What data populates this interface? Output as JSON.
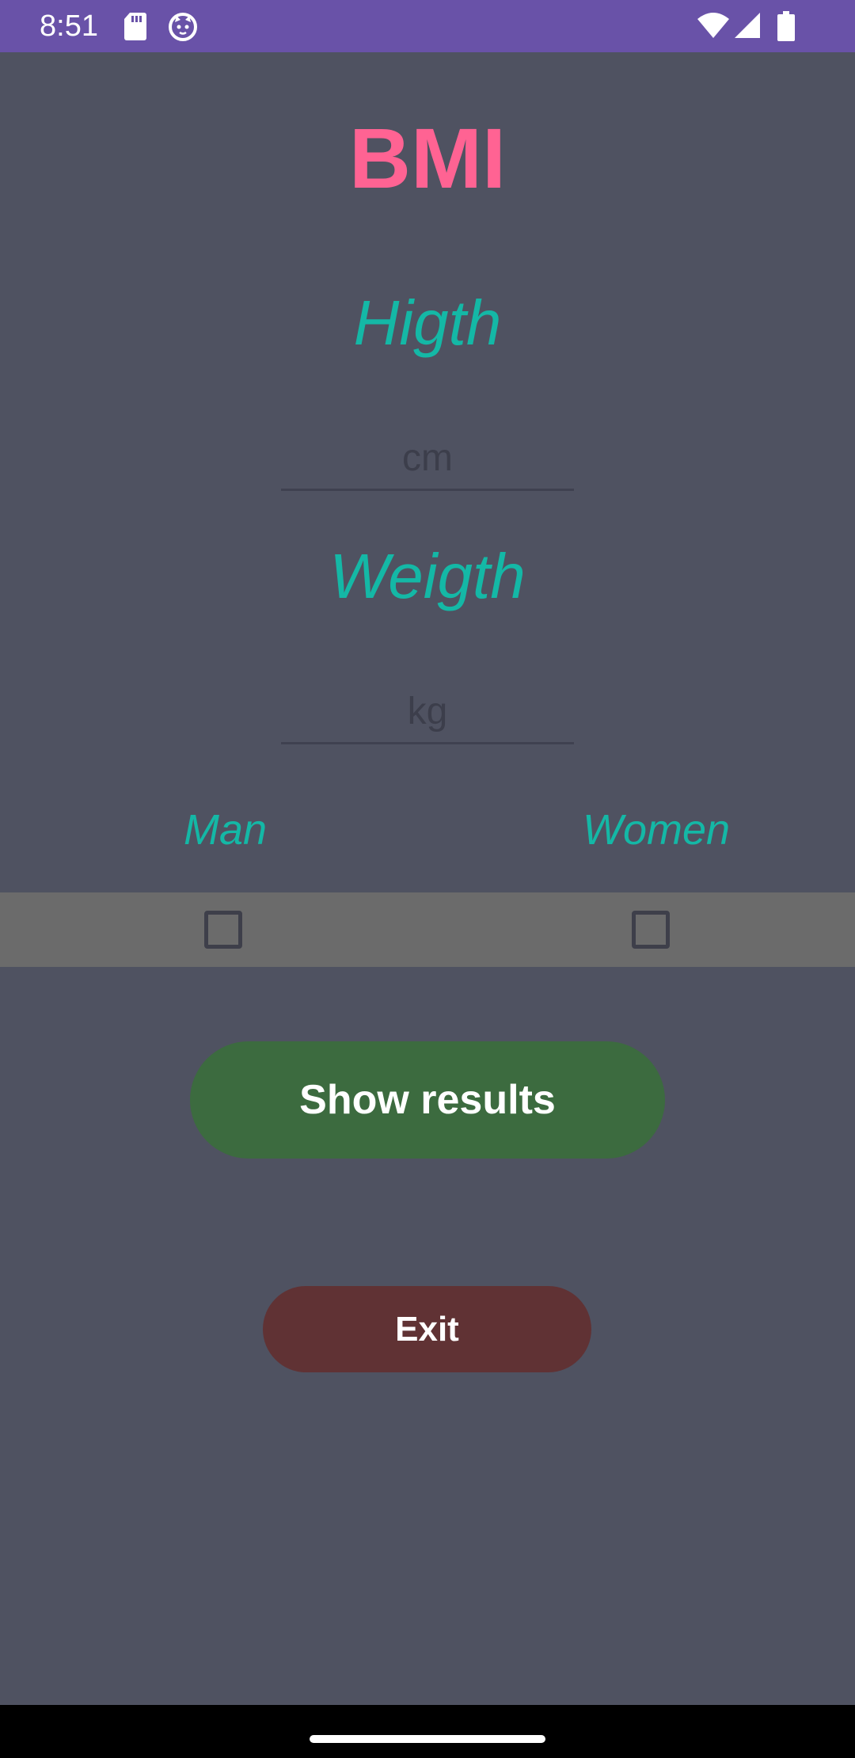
{
  "status_bar": {
    "time": "8:51",
    "background_color": "#6952a8",
    "icons": [
      "sd-card-icon",
      "cat-icon",
      "wifi-icon",
      "cell-signal-icon",
      "battery-icon"
    ]
  },
  "app": {
    "title": "BMI",
    "height_label": "Higth",
    "height_placeholder": "cm",
    "height_value": "",
    "weight_label": "Weigth",
    "weight_placeholder": "kg",
    "weight_value": "",
    "gender": {
      "man_label": "Man",
      "women_label": "Women",
      "man_checked": false,
      "women_checked": false
    },
    "show_results_label": "Show results",
    "exit_label": "Exit"
  },
  "colors": {
    "background": "#4f5261",
    "title": "#ff6393",
    "labels": "#14b8a6",
    "checkbox_band": "#6b6b6b",
    "show_results_button": "#3c6b3f",
    "exit_button": "#603234"
  }
}
